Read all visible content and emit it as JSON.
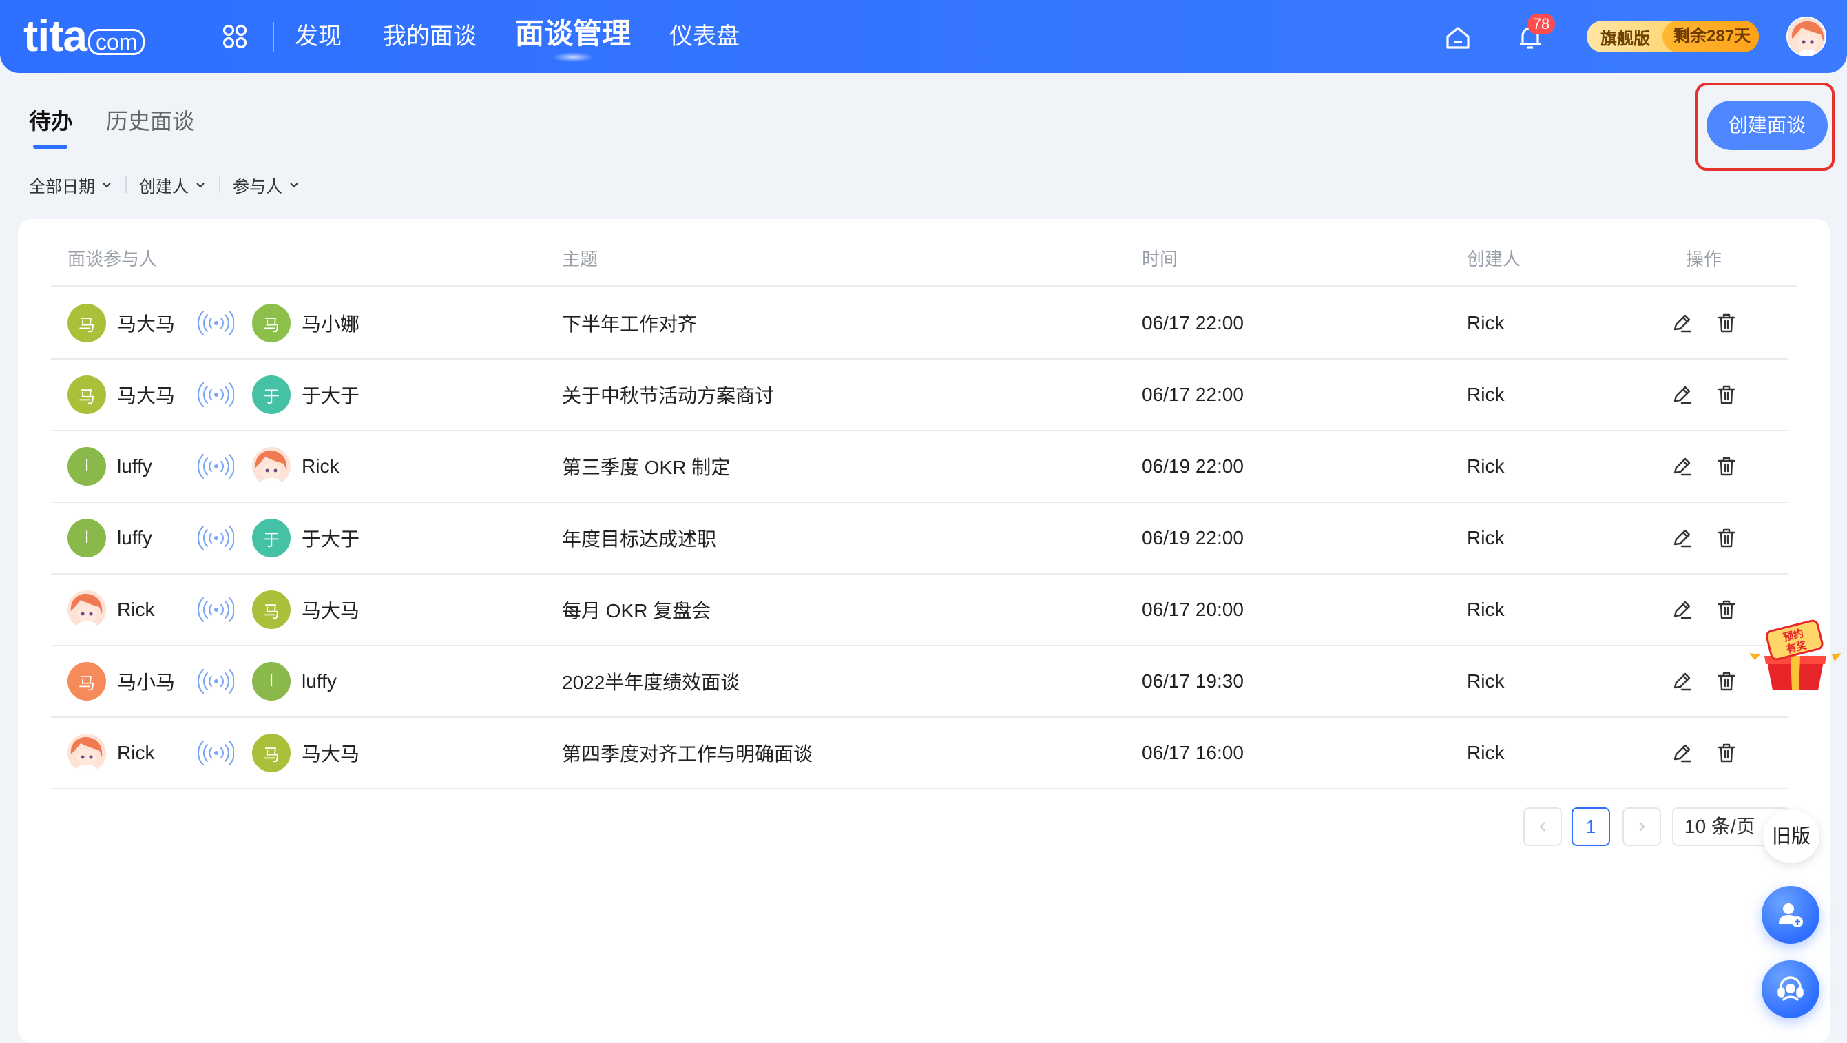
{
  "brand": {
    "logo_main": "tita",
    "logo_suffix": "com"
  },
  "nav": [
    {
      "label": "发现",
      "active": false
    },
    {
      "label": "我的面谈",
      "active": false
    },
    {
      "label": "面谈管理",
      "active": true
    },
    {
      "label": "仪表盘",
      "active": false
    }
  ],
  "header": {
    "notification_count": "78",
    "plan_name": "旗舰版",
    "plan_remaining": "剩余287天"
  },
  "tabs": [
    {
      "label": "待办",
      "active": true
    },
    {
      "label": "历史面谈",
      "active": false
    }
  ],
  "create_button": "创建面谈",
  "filters": [
    "全部日期",
    "创建人",
    "参与人"
  ],
  "table": {
    "columns": [
      "面谈参与人",
      "主题",
      "时间",
      "创建人",
      "操作"
    ],
    "rows": [
      {
        "p1": {
          "name": "马大马",
          "avatar_text": "马",
          "color": "#a9c13a",
          "photo": false
        },
        "p2": {
          "name": "马小娜",
          "avatar_text": "马",
          "color": "#8cc04a",
          "photo": false
        },
        "topic": "下半年工作对齐",
        "time": "06/17 22:00",
        "creator": "Rick"
      },
      {
        "p1": {
          "name": "马大马",
          "avatar_text": "马",
          "color": "#a9c13a",
          "photo": false
        },
        "p2": {
          "name": "于大于",
          "avatar_text": "于",
          "color": "#45c2a6",
          "photo": false
        },
        "topic": "关于中秋节活动方案商讨",
        "time": "06/17 22:00",
        "creator": "Rick"
      },
      {
        "p1": {
          "name": "luffy",
          "avatar_text": "l",
          "color": "#8bb84a",
          "photo": false
        },
        "p2": {
          "name": "Rick",
          "avatar_text": "",
          "color": "#f4a085",
          "photo": true
        },
        "topic": "第三季度 OKR 制定",
        "time": "06/19 22:00",
        "creator": "Rick"
      },
      {
        "p1": {
          "name": "luffy",
          "avatar_text": "l",
          "color": "#8bb84a",
          "photo": false
        },
        "p2": {
          "name": "于大于",
          "avatar_text": "于",
          "color": "#45c2a6",
          "photo": false
        },
        "topic": "年度目标达成述职",
        "time": "06/19 22:00",
        "creator": "Rick"
      },
      {
        "p1": {
          "name": "Rick",
          "avatar_text": "",
          "color": "#f4a085",
          "photo": true
        },
        "p2": {
          "name": "马大马",
          "avatar_text": "马",
          "color": "#a9c13a",
          "photo": false
        },
        "topic": "每月 OKR 复盘会",
        "time": "06/17 20:00",
        "creator": "Rick"
      },
      {
        "p1": {
          "name": "马小马",
          "avatar_text": "马",
          "color": "#f58a5a",
          "photo": false
        },
        "p2": {
          "name": "luffy",
          "avatar_text": "l",
          "color": "#8bb84a",
          "photo": false
        },
        "topic": "2022半年度绩效面谈",
        "time": "06/17 19:30",
        "creator": "Rick"
      },
      {
        "p1": {
          "name": "Rick",
          "avatar_text": "",
          "color": "#f4a085",
          "photo": true
        },
        "p2": {
          "name": "马大马",
          "avatar_text": "马",
          "color": "#a9c13a",
          "photo": false
        },
        "topic": "第四季度对齐工作与明确面谈",
        "time": "06/17 16:00",
        "creator": "Rick"
      }
    ]
  },
  "pagination": {
    "current_page": "1",
    "page_size": "10 条/页"
  },
  "floating": {
    "old_version": "旧版",
    "gift_text": "预约有奖"
  },
  "colors": {
    "primary": "#2f6fff",
    "danger": "#e5322d",
    "badge": "#ff4d4f"
  }
}
